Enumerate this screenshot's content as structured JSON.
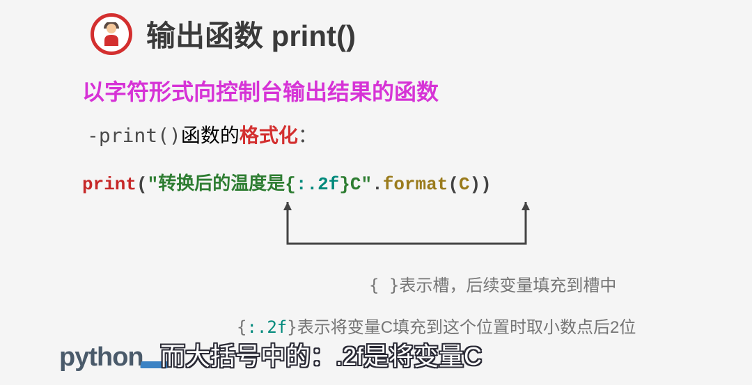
{
  "header": {
    "title": "输出函数 print()"
  },
  "subtitle": "以字符形式向控制台输出结果的函数",
  "line3": {
    "dash": "-",
    "print": "print()",
    "text1": "函数的",
    "red": "格式化",
    "colon": "："
  },
  "code": {
    "print": "print",
    "paren1": "(",
    "quote1": "\"",
    "str1": "转换后的温度是",
    "brace1": "{",
    "fmt": ":.2f",
    "brace2": "}",
    "str2": "C",
    "quote2": "\"",
    "dot": ".",
    "format": "format",
    "paren2": "(",
    "var": "C",
    "paren3": ")",
    "paren4": ")"
  },
  "note1": {
    "brace": "{ }",
    "text": "表示槽，后续变量填充到槽中"
  },
  "note2": {
    "brace1": "{",
    "fmt": ":.2f",
    "brace2": "}",
    "text": "表示将变量C填充到这个位置时取小数点后2位"
  },
  "logo": "python",
  "caption": "而大括号中的：.2f是将变量C"
}
